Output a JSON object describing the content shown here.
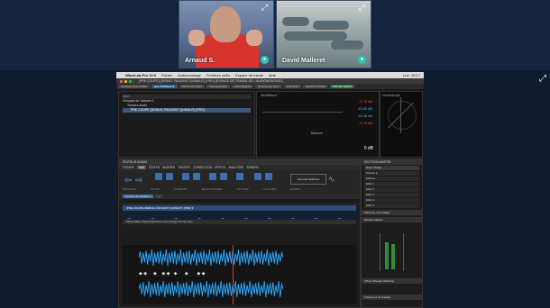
{
  "call": {
    "participants": [
      {
        "name": "Arnaud S.",
        "muted": false
      },
      {
        "name": "David Malleret",
        "muted": false
      }
    ]
  },
  "macos": {
    "apple": "",
    "app_name": "WaveLab Pro 10.0",
    "menus": [
      "Fichier",
      "Audiomontage",
      "Fenêtres outils",
      "Espace de travail",
      "Aide"
    ],
    "clock": "Lun. 10:17"
  },
  "app": {
    "window_title": "[PRE COUPE] (DEBUG: PAUSANT QUINAUT) (PRO) [ESPACE DE TRAVAIL DE L'AUDIOMONTAGE]",
    "tabs": [
      {
        "label": "NAVIGATEUR ACIBA",
        "state": "normal"
      },
      {
        "label": "LES PANNEAUX",
        "state": "active"
      },
      {
        "label": "METACHLORES",
        "state": "normal"
      },
      {
        "label": "MARQUEURS",
        "state": "normal"
      },
      {
        "label": "HISTORIQUE",
        "state": "normal"
      },
      {
        "label": "BLOCS DE TEXT",
        "state": "normal"
      },
      {
        "label": "EDITEUR",
        "state": "normal"
      },
      {
        "label": "ENREGISTRER",
        "state": "normal"
      },
      {
        "label": "PROJET (EDIT)",
        "state": "green"
      }
    ],
    "tree_panel": {
      "column_name": "Nom",
      "items": [
        "Groupes de Voitures 1",
        "Tonners audio",
        "PRE COUPE (DEBUG: PAUSANT QUINAUT) (PRO)"
      ]
    },
    "meter_panel": {
      "title": "Ventilateurs",
      "readouts": [
        {
          "value": "-2.78 dB",
          "color": "#ff4444"
        },
        {
          "value": "-13.80 dB",
          "color": "#5ab4ff"
        },
        {
          "value": "-13.48 dB",
          "color": "#5ab4ff"
        },
        {
          "value": "-1.79 dB",
          "color": "#ff4444"
        }
      ],
      "scale_label": "Balance",
      "zero_db_label": "0 dB",
      "bottom_readout": "0 dB"
    },
    "scope_panel": {
      "title": "Oscilloscope"
    },
    "editor": {
      "title": "ÉDITEUR AUDIO",
      "tabs": [
        "FICHIER",
        "VUE",
        "ÉDITER",
        "INSÉRER",
        "TRAITER",
        "CORRECTION",
        "EFFETS",
        "ANALYSER",
        "RENDRE"
      ],
      "active_tab": "VUE",
      "toolbar_groups": [
        "NAVIGUER",
        "ZOOM",
        "CURSEUR",
        "SÉLECTIONNER",
        "ACTIVER",
        "CALQUES",
        "EFFETS"
      ],
      "processing_label": "Nouvelle Sélection",
      "timeline_tabs": [
        "Groupe de Voitures 1",
        "+"
      ],
      "file_label": "[PRE COUPE] (DEBUG: PAUSANT QUINAUT) (PRO) ▾",
      "track_header": "Mode Edition   Spectrogramme   Chronologie   Source   Flux"
    },
    "right_panel": {
      "title": "SECTION MAÎTRE",
      "preset_label": "Nouv. Préset",
      "rows": [
        "Présets ▸",
        "Effets ▸",
        "Effet 1",
        "Effet 2",
        "Effet 3",
        "Effet 4",
        "Effet 5"
      ],
      "section_dithering": "Dithering / Encodage",
      "section_mix": "Niveaux Master",
      "section_output": "Offres (Niveau) Dithering",
      "section_trim": "Traitement du finaliser"
    }
  }
}
